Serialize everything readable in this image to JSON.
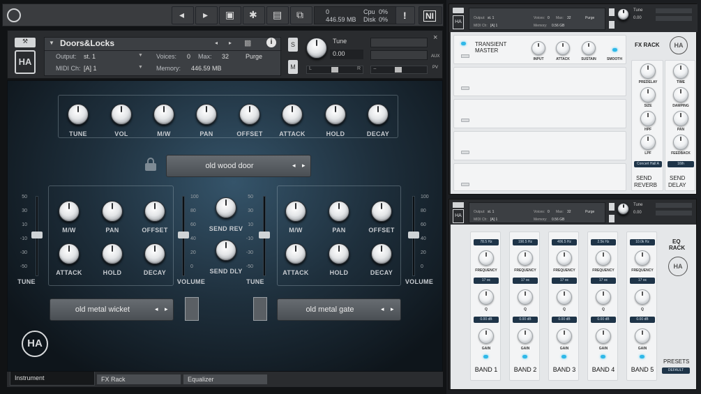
{
  "top_toolbar": {
    "midi_count": "0",
    "memory": "446.59 MB",
    "cpu_label": "Cpu",
    "cpu_value": "0%",
    "disk_label": "Disk",
    "disk_value": "0%",
    "warning": "!",
    "ni_logo": "NI"
  },
  "instrument": {
    "name": "Doors&Locks",
    "output_label": "Output:",
    "output_value": "st. 1",
    "voices_label": "Voices:",
    "voices_value": "0",
    "max_label": "Max:",
    "max_value": "32",
    "purge_label": "Purge",
    "midi_label": "MIDI Ch:",
    "midi_value": "[A]  1",
    "memory_label": "Memory:",
    "memory_value": "446.59 MB",
    "tune_label": "Tune",
    "tune_value": "0.00",
    "s_button": "S",
    "m_button": "M",
    "l_label": "L",
    "r_label": "R",
    "aux_label": "AUX",
    "pv_label": "PV",
    "close": "×",
    "minus": "−"
  },
  "main_panel": {
    "top_knobs": [
      "TUNE",
      "VOL",
      "M/W",
      "PAN",
      "OFFSET",
      "ATTACK",
      "HOLD",
      "DECAY"
    ],
    "center_sample": "old wood door",
    "left_knobs": [
      "M/W",
      "PAN",
      "OFFSET",
      "ATTACK",
      "HOLD",
      "DECAY"
    ],
    "right_knobs": [
      "M/W",
      "PAN",
      "OFFSET",
      "ATTACK",
      "HOLD",
      "DECAY"
    ],
    "send_rev": "SEND REV",
    "send_dly": "SEND DLY",
    "left_slider_label": "TUNE",
    "left_volume_label": "VOLUME",
    "right_slider_label": "TUNE",
    "right_volume_label": "VOLUME",
    "tune_ticks": [
      "50",
      "30",
      "10",
      "-10",
      "-30",
      "-50"
    ],
    "volume_ticks": [
      "100",
      "80",
      "60",
      "40",
      "20",
      "0"
    ],
    "left_sample": "old metal wicket",
    "right_sample": "old metal gate"
  },
  "bottom_tabs": [
    "Instrument",
    "FX Rack",
    "Equalizer"
  ],
  "fx_window": {
    "output_value": "st. 1",
    "voices_value": "0",
    "max_value": "32",
    "purge_label": "Purge",
    "midi_value": "[A]  1",
    "memory_value": "0.56 GB",
    "tune_label": "Tune",
    "tune_value": "0.00",
    "transient_title_1": "TRANSIENT",
    "transient_title_2": "MASTER",
    "transient_knobs": [
      "INPUT",
      "ATTACK",
      "SUSTAIN"
    ],
    "smooth_label": "SMOOTH",
    "fx_rack_title": "FX RACK",
    "reverb_knobs": [
      "PREDELAY",
      "SIZE",
      "HPF",
      "LPF"
    ],
    "delay_knobs": [
      "TIME",
      "DAMPING",
      "PAN",
      "FEEDBACK"
    ],
    "reverb_preset": "Concert Hall A",
    "delay_preset": "16th",
    "send_reverb_1": "SEND",
    "send_reverb_2": "REVERB",
    "send_delay_1": "SEND",
    "send_delay_2": "DELAY"
  },
  "eq_window": {
    "output_value": "st. 1",
    "voices_value": "0",
    "max_value": "32",
    "purge_label": "Purge",
    "midi_value": "[A]  1",
    "memory_value": "0.56 GB",
    "tune_label": "Tune",
    "tune_value": "0.00",
    "eq_title_1": "EQ",
    "eq_title_2": "RACK",
    "presets_label": "PRESETS",
    "preset_value": "DEFAULT",
    "frequency_label": "FREQUENCY",
    "q_label": "Q",
    "gain_label": "GAIN",
    "bands": [
      {
        "label": "BAND 1",
        "freq": "78.5 Hz",
        "q": "17 oc",
        "gain": "0.00 dB"
      },
      {
        "label": "BAND 2",
        "freq": "190.5 Hz",
        "q": "17 oc",
        "gain": "0.00 dB"
      },
      {
        "label": "BAND 3",
        "freq": "406.5 Hz",
        "q": "17 oc",
        "gain": "0.00 dB"
      },
      {
        "label": "BAND 4",
        "freq": "2.5k Hz",
        "q": "17 oc",
        "gain": "0.00 dB"
      },
      {
        "label": "BAND 5",
        "freq": "10.0k Hz",
        "q": "17 oc",
        "gain": "0.00 dB"
      }
    ]
  },
  "colors": {
    "accent": "#2fb8e8",
    "value_box": "#1e3448",
    "panel_bg": "#eceeef"
  }
}
